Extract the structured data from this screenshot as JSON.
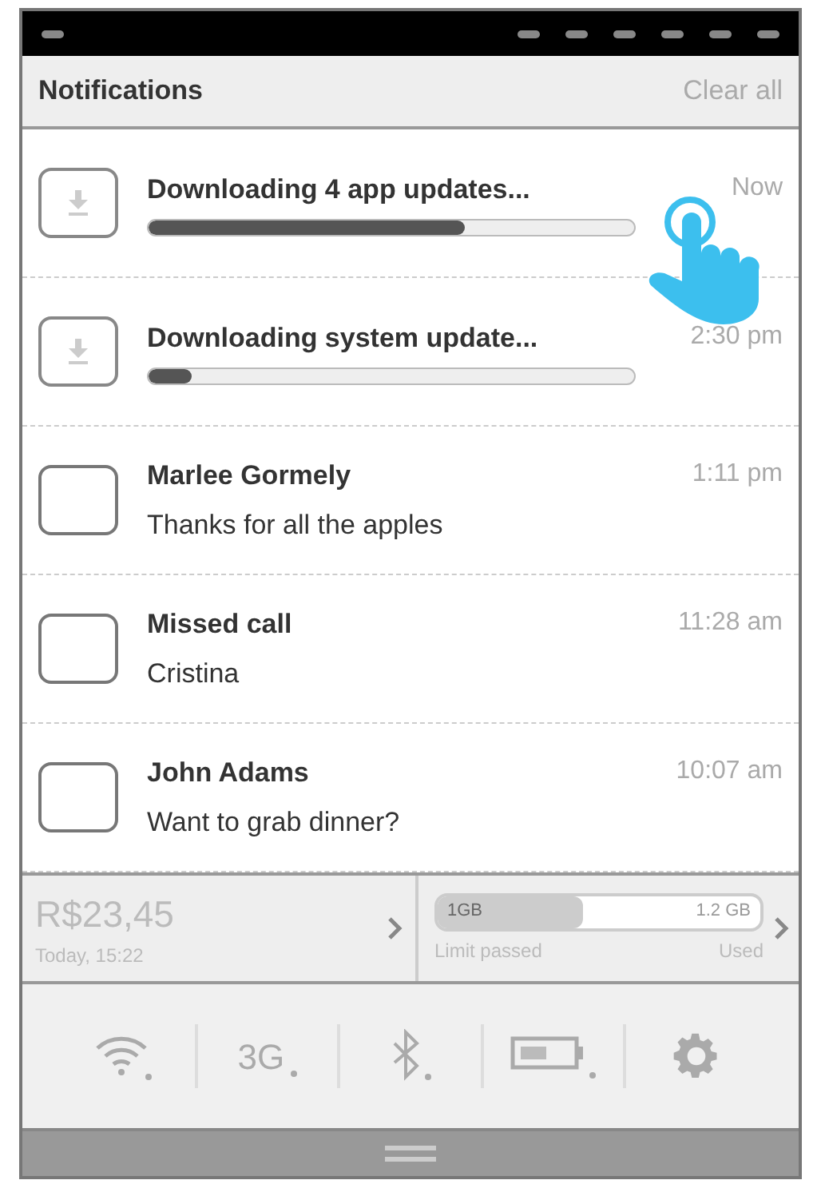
{
  "header": {
    "title": "Notifications",
    "action": "Clear all"
  },
  "notifications": [
    {
      "kind": "download",
      "title": "Downloading 4 app updates...",
      "time": "Now",
      "level": 0.65
    },
    {
      "kind": "download",
      "title": "Downloading system update...",
      "time": "2:30 pm",
      "level": 0.09
    },
    {
      "kind": "message",
      "title": "Marlee Gormely",
      "body": "Thanks for all the apples",
      "time": "1:11 pm"
    },
    {
      "kind": "message",
      "title": "Missed call",
      "body": "Cristina",
      "time": "11:28 am"
    },
    {
      "kind": "message",
      "title": "John Adams",
      "body": "Want to grab dinner?",
      "time": "10:07 am"
    }
  ],
  "balance": {
    "amount": "R$23,45",
    "updated": "Today, 15:22"
  },
  "data_usage": {
    "limit": "1GB",
    "total": "1.2 GB",
    "level": 0.45,
    "status": "Limit passed",
    "caption": "Used"
  },
  "toggles": [
    {
      "kind": "wifi"
    },
    {
      "kind": "network",
      "label": "3G"
    },
    {
      "kind": "bluetooth"
    },
    {
      "kind": "battery"
    },
    {
      "kind": "settings"
    }
  ]
}
